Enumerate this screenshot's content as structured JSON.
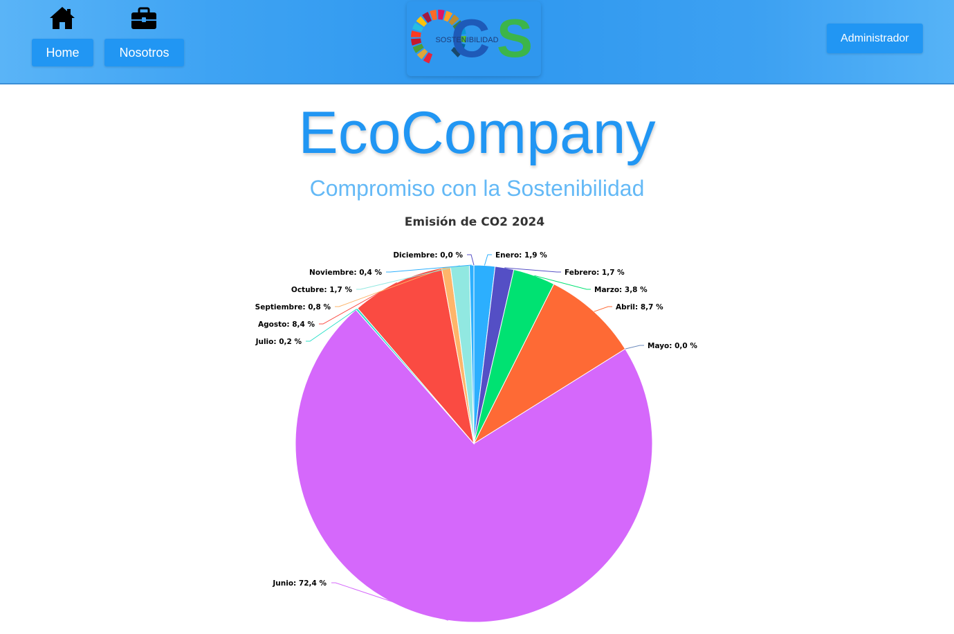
{
  "nav": {
    "home_label": "Home",
    "home_icon": "home-icon",
    "nosotros_label": "Nosotros",
    "nosotros_icon": "briefcase-icon",
    "logo_text": "SOSTENIBILIDAD",
    "logo_letters": "CS",
    "admin_label": "Administrador",
    "colors": {
      "bar": "#2e97ef",
      "button": "#2196f3",
      "logo_c": "#1e5ab8",
      "logo_s": "#3cb54a"
    }
  },
  "hero": {
    "title": "EcoCompany",
    "subtitle": "Compromiso con la Sostenibilidad"
  },
  "chart_data": {
    "type": "pie",
    "title": "Emisión de CO2 2024",
    "value_unit": "%",
    "slices": [
      {
        "name": "Enero",
        "value": 1.9,
        "label": "Enero: 1,9 %",
        "color": "#2caffe"
      },
      {
        "name": "Febrero",
        "value": 1.7,
        "label": "Febrero: 1,7 %",
        "color": "#544fc5"
      },
      {
        "name": "Marzo",
        "value": 3.8,
        "label": "Marzo: 3,8 %",
        "color": "#00e272"
      },
      {
        "name": "Abril",
        "value": 8.7,
        "label": "Abril: 8,7 %",
        "color": "#fe6a35"
      },
      {
        "name": "Mayo",
        "value": 0.0,
        "label": "Mayo: 0,0 %",
        "color": "#6b8abc"
      },
      {
        "name": "Junio",
        "value": 72.4,
        "label": "Junio: 72,4 %",
        "color": "#d568fb"
      },
      {
        "name": "Julio",
        "value": 0.2,
        "label": "Julio: 0,2 %",
        "color": "#2ee0ca"
      },
      {
        "name": "Agosto",
        "value": 8.4,
        "label": "Agosto: 8,4 %",
        "color": "#fa4b42"
      },
      {
        "name": "Septiembre",
        "value": 0.8,
        "label": "Septiembre: 0,8 %",
        "color": "#feb56a"
      },
      {
        "name": "Octubre",
        "value": 1.7,
        "label": "Octubre: 1,7 %",
        "color": "#91e8e1"
      },
      {
        "name": "Noviembre",
        "value": 0.4,
        "label": "Noviembre: 0,4 %",
        "color": "#2caffe"
      },
      {
        "name": "Diciembre",
        "value": 0.0,
        "label": "Diciembre: 0,0 %",
        "color": "#544fc5"
      }
    ]
  }
}
